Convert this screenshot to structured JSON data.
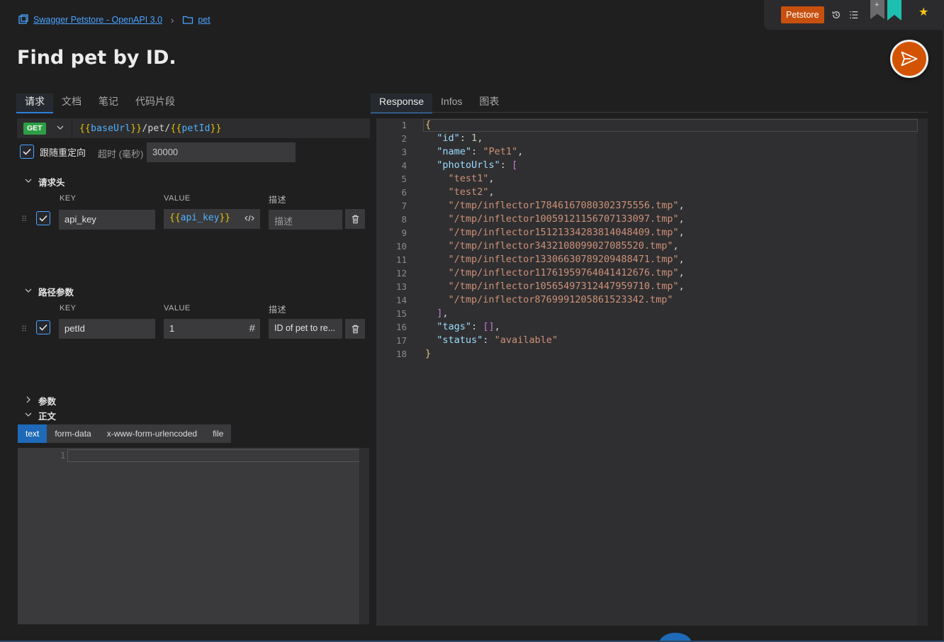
{
  "breadcrumb": {
    "collection": "Swagger Petstore - OpenAPI 3.0",
    "folder": "pet"
  },
  "top_right": {
    "environment": "Petstore",
    "bookmark_plus": "+"
  },
  "title": "Find pet by ID.",
  "left_tabs": [
    "请求",
    "文档",
    "笔记",
    "代码片段"
  ],
  "right_tabs": [
    "Response",
    "Infos",
    "图表"
  ],
  "request": {
    "method": "GET",
    "url_parts": [
      {
        "t": "{{",
        "c": "var"
      },
      {
        "t": "baseUrl",
        "c": "varname"
      },
      {
        "t": "}}",
        "c": "var"
      },
      {
        "t": "/pet/",
        "c": "plain"
      },
      {
        "t": "{{",
        "c": "var"
      },
      {
        "t": "petId",
        "c": "varname"
      },
      {
        "t": "}}",
        "c": "var"
      }
    ],
    "follow_redirect_label": "跟随重定向",
    "timeout_label": "超时 (毫秒)",
    "timeout_value": "30000"
  },
  "headers_section": {
    "title": "请求头",
    "col_key": "KEY",
    "col_value": "VALUE",
    "col_desc": "描述",
    "row": {
      "key": "api_key",
      "value_open": "{{",
      "value_name": "api_key",
      "value_close": "}}",
      "desc_placeholder": "描述"
    }
  },
  "path_section": {
    "title": "路径参数",
    "col_key": "KEY",
    "col_value": "VALUE",
    "col_desc": "描述",
    "row": {
      "key": "petId",
      "value": "1",
      "desc": "ID of pet to re..."
    }
  },
  "params_section": {
    "title": "参数"
  },
  "body_section": {
    "title": "正文",
    "tabs": [
      "text",
      "form-data",
      "x-www-form-urlencoded",
      "file"
    ],
    "active_tab": "text",
    "line_number": "1"
  },
  "response_lines": [
    [
      {
        "t": "{",
        "c": "b1"
      }
    ],
    [
      {
        "t": "  "
      },
      {
        "t": "\"id\"",
        "c": "k"
      },
      {
        "t": ": ",
        "c": "p"
      },
      {
        "t": "1",
        "c": "n"
      },
      {
        "t": ",",
        "c": "p"
      }
    ],
    [
      {
        "t": "  "
      },
      {
        "t": "\"name\"",
        "c": "k"
      },
      {
        "t": ": ",
        "c": "p"
      },
      {
        "t": "\"Pet1\"",
        "c": "s"
      },
      {
        "t": ",",
        "c": "p"
      }
    ],
    [
      {
        "t": "  "
      },
      {
        "t": "\"photoUrls\"",
        "c": "k"
      },
      {
        "t": ": ",
        "c": "p"
      },
      {
        "t": "[",
        "c": "b2"
      }
    ],
    [
      {
        "t": "    "
      },
      {
        "t": "\"test1\"",
        "c": "s"
      },
      {
        "t": ",",
        "c": "p"
      }
    ],
    [
      {
        "t": "    "
      },
      {
        "t": "\"test2\"",
        "c": "s"
      },
      {
        "t": ",",
        "c": "p"
      }
    ],
    [
      {
        "t": "    "
      },
      {
        "t": "\"/tmp/inflector17846167080302375556.tmp\"",
        "c": "s"
      },
      {
        "t": ",",
        "c": "p"
      }
    ],
    [
      {
        "t": "    "
      },
      {
        "t": "\"/tmp/inflector10059121156707133097.tmp\"",
        "c": "s"
      },
      {
        "t": ",",
        "c": "p"
      }
    ],
    [
      {
        "t": "    "
      },
      {
        "t": "\"/tmp/inflector15121334283814048409.tmp\"",
        "c": "s"
      },
      {
        "t": ",",
        "c": "p"
      }
    ],
    [
      {
        "t": "    "
      },
      {
        "t": "\"/tmp/inflector3432108099027085520.tmp\"",
        "c": "s"
      },
      {
        "t": ",",
        "c": "p"
      }
    ],
    [
      {
        "t": "    "
      },
      {
        "t": "\"/tmp/inflector13306630789209488471.tmp\"",
        "c": "s"
      },
      {
        "t": ",",
        "c": "p"
      }
    ],
    [
      {
        "t": "    "
      },
      {
        "t": "\"/tmp/inflector11761959764041412676.tmp\"",
        "c": "s"
      },
      {
        "t": ",",
        "c": "p"
      }
    ],
    [
      {
        "t": "    "
      },
      {
        "t": "\"/tmp/inflector10565497312447959710.tmp\"",
        "c": "s"
      },
      {
        "t": ",",
        "c": "p"
      }
    ],
    [
      {
        "t": "    "
      },
      {
        "t": "\"/tmp/inflector8769991205861523342.tmp\"",
        "c": "s"
      }
    ],
    [
      {
        "t": "  "
      },
      {
        "t": "]",
        "c": "b2"
      },
      {
        "t": ",",
        "c": "p"
      }
    ],
    [
      {
        "t": "  "
      },
      {
        "t": "\"tags\"",
        "c": "k"
      },
      {
        "t": ": ",
        "c": "p"
      },
      {
        "t": "[]",
        "c": "b2"
      },
      {
        "t": ",",
        "c": "p"
      }
    ],
    [
      {
        "t": "  "
      },
      {
        "t": "\"status\"",
        "c": "k"
      },
      {
        "t": ": ",
        "c": "p"
      },
      {
        "t": "\"available\"",
        "c": "s"
      }
    ],
    [
      {
        "t": "}",
        "c": "b1"
      }
    ]
  ],
  "colors": {
    "accent": "#2f7ed8",
    "send": "#d35400",
    "env": "#c8500e",
    "method_get": "#2e9e45"
  }
}
